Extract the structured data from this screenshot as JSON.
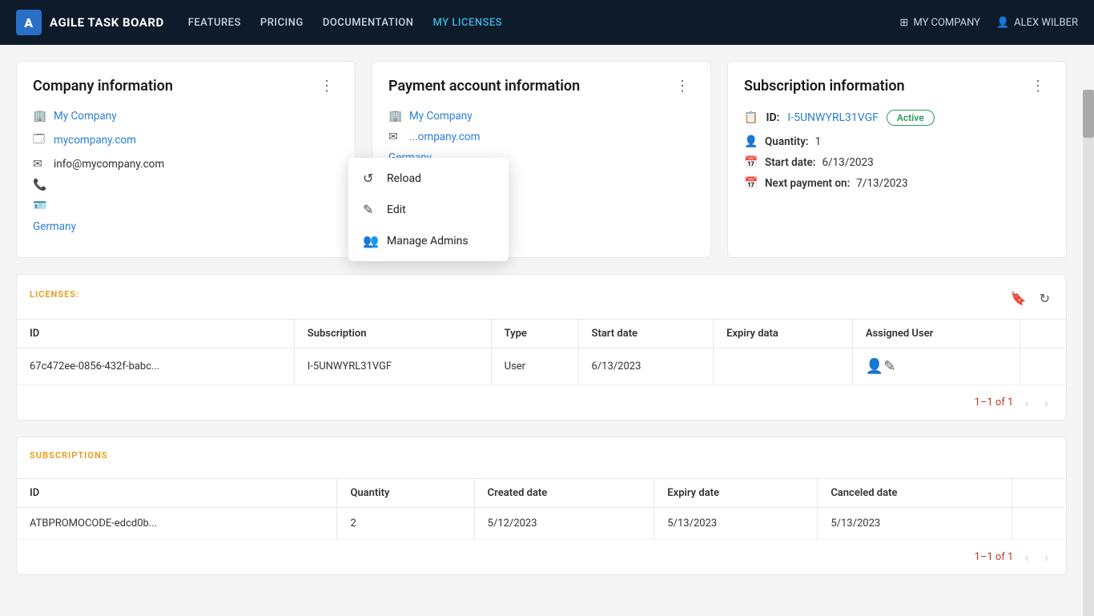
{
  "navbar": {
    "brand_icon": "a",
    "brand_name": "AGILE TASK BOARD",
    "nav_links": [
      {
        "label": "FEATURES",
        "active": false
      },
      {
        "label": "PRICING",
        "active": false
      },
      {
        "label": "DOCUMENTATION",
        "active": false
      },
      {
        "label": "MY LICENSES",
        "active": true
      }
    ],
    "company_label": "MY COMPANY",
    "user_label": "ALEX WILBER"
  },
  "dropdown": {
    "items": [
      {
        "label": "Reload",
        "icon": "↺"
      },
      {
        "label": "Edit",
        "icon": "✎"
      },
      {
        "label": "Manage Admins",
        "icon": "👥"
      }
    ]
  },
  "company_card": {
    "title": "Company information",
    "company_name": "My Company",
    "website": "mycompany.com",
    "email": "info@mycompany.com",
    "country": "Germany"
  },
  "payment_card": {
    "title": "Payment account information",
    "company_name": "My Company",
    "email_domain": "ompany.com",
    "country": "Germany"
  },
  "subscription_card": {
    "title": "Subscription information",
    "id_label": "ID:",
    "id_value": "I-5UNWYRL31VGF",
    "status": "Active",
    "quantity_label": "Quantity:",
    "quantity_value": "1",
    "start_date_label": "Start date:",
    "start_date_value": "6/13/2023",
    "next_payment_label": "Next payment on:",
    "next_payment_value": "7/13/2023"
  },
  "licenses_section": {
    "label": "LICENSES:",
    "columns": [
      "ID",
      "Subscription",
      "Type",
      "Start date",
      "Expiry data",
      "Assigned User"
    ],
    "rows": [
      {
        "id": "67c472ee-0856-432f-babc...",
        "subscription": "I-5UNWYRL31VGF",
        "type": "User",
        "start_date": "6/13/2023",
        "expiry_data": "",
        "assigned_user": ""
      }
    ],
    "pagination": "1–1 of 1"
  },
  "subscriptions_section": {
    "label": "SUBSCRIPTIONS",
    "columns": [
      "ID",
      "Quantity",
      "Created date",
      "Expiry date",
      "Canceled date"
    ],
    "rows": [
      {
        "id": "ATBPROMOCODE-edcd0b...",
        "quantity": "2",
        "created_date": "5/12/2023",
        "expiry_date": "5/13/2023",
        "canceled_date": "5/13/2023"
      }
    ],
    "pagination": "1–1 of 1"
  }
}
